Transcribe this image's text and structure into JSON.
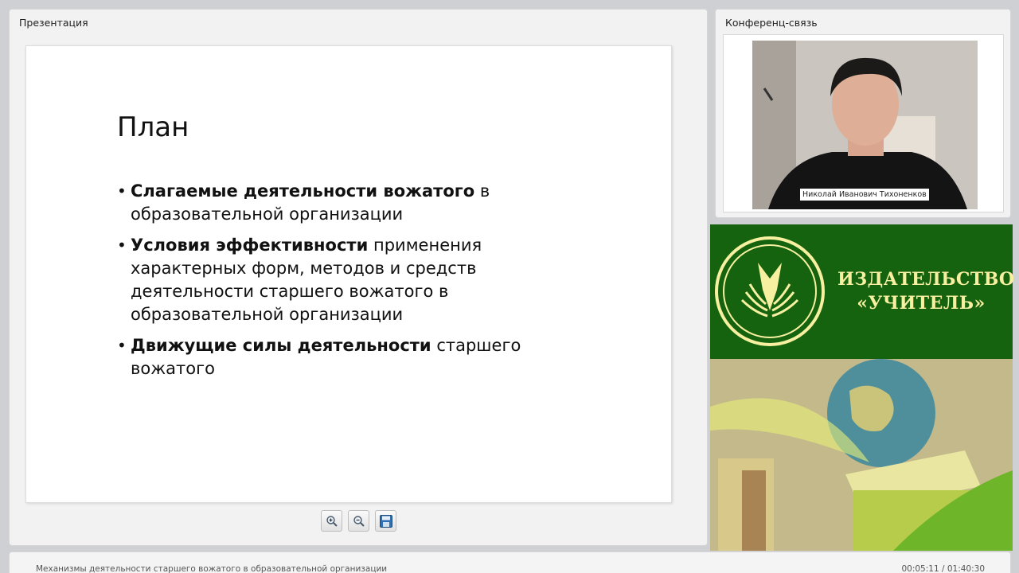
{
  "presentation": {
    "panel_title": "Презентация",
    "slide": {
      "title": "План",
      "bullets": [
        {
          "bold": "Слагаемые деятельности вожатого",
          "rest": " в образовательной организации"
        },
        {
          "bold": "Условия эффективности",
          "rest": " применения характерных форм, методов и средств деятельности старшего вожатого в образовательной организации"
        },
        {
          "bold": "Движущие силы деятельности",
          "rest": " старшего вожатого"
        }
      ]
    },
    "toolbar": {
      "zoom_in_icon": "zoom-in-icon",
      "zoom_out_icon": "zoom-out-icon",
      "save_icon": "save-icon"
    }
  },
  "conference": {
    "panel_title": "Конференц-связь",
    "speaker_name": "Николай Иванович Тихоненков"
  },
  "ad": {
    "line1": "ИЗДАТЕЛЬСТВО",
    "line2": "«УЧИТЕЛЬ»",
    "brand_color": "#15620f",
    "text_color": "#f6f0a0"
  },
  "status": {
    "title": "Механизмы деятельности старшего вожатого в образовательной организации",
    "time": "00:05:11 / 01:40:30"
  }
}
